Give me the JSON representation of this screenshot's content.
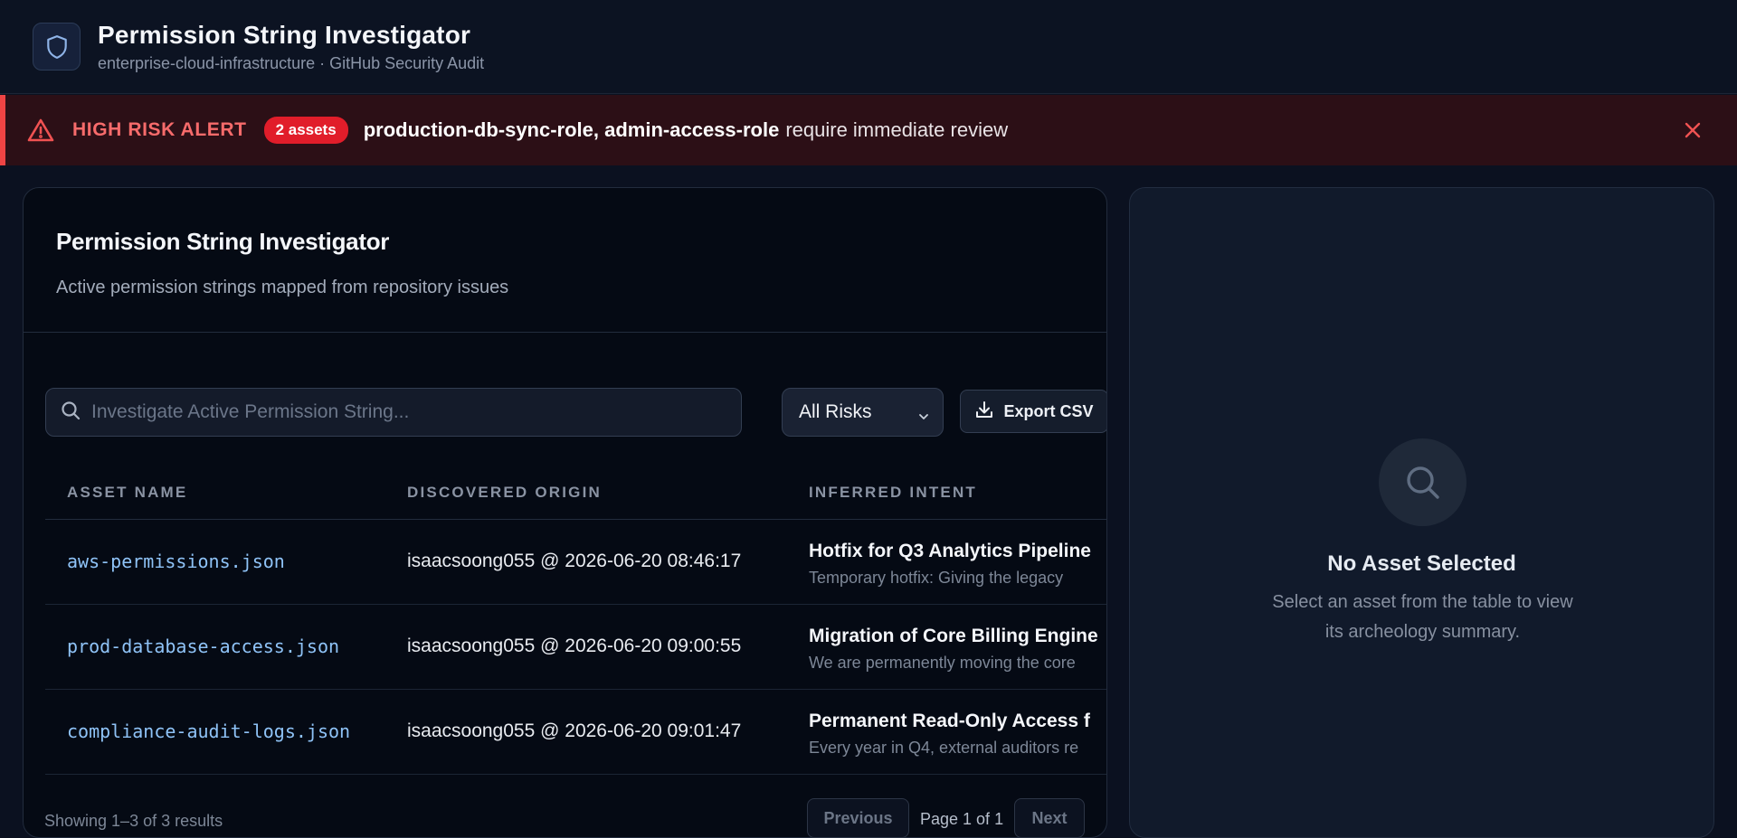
{
  "header": {
    "title": "Permission String Investigator",
    "subtitle": "enterprise-cloud-infrastructure · GitHub Security Audit"
  },
  "alert": {
    "title": "HIGH RISK ALERT",
    "badge": "2 assets",
    "assets": "production-db-sync-role, admin-access-role",
    "message": "require immediate review"
  },
  "panel": {
    "title": "Permission String Investigator",
    "description": "Active permission strings mapped from repository issues"
  },
  "toolbar": {
    "search_placeholder": "Investigate Active Permission String...",
    "risk_filter": "All Risks",
    "export_label": "Export CSV"
  },
  "table": {
    "headers": {
      "asset": "ASSET NAME",
      "origin": "DISCOVERED ORIGIN",
      "intent": "INFERRED INTENT"
    },
    "rows": [
      {
        "asset": "aws-permissions.json",
        "origin": "isaacsoong055 @ 2026-06-20 08:46:17",
        "intent_title": "Hotfix for Q3 Analytics Pipeline",
        "intent_desc": "Temporary hotfix: Giving the legacy"
      },
      {
        "asset": "prod-database-access.json",
        "origin": "isaacsoong055 @ 2026-06-20 09:00:55",
        "intent_title": "Migration of Core Billing Engine",
        "intent_desc": "We are permanently moving the core"
      },
      {
        "asset": "compliance-audit-logs.json",
        "origin": "isaacsoong055 @ 2026-06-20 09:01:47",
        "intent_title": "Permanent Read-Only Access f",
        "intent_desc": "Every year in Q4, external auditors re"
      }
    ]
  },
  "pagination": {
    "results": "Showing 1–3 of 3 results",
    "previous": "Previous",
    "page_info": "Page 1 of 1",
    "next": "Next"
  },
  "side_panel": {
    "empty_title": "No Asset Selected",
    "empty_description": "Select an asset from the table to view its archeology summary."
  },
  "colors": {
    "background": "#0b1120",
    "alert_red": "#ef4444",
    "link_blue": "#8fc3f7"
  },
  "icons": {
    "logo": "shield-icon",
    "alert": "warning-triangle-icon",
    "close": "close-icon",
    "search": "search-icon",
    "dropdown": "chevron-down-icon",
    "export": "download-icon",
    "empty_state": "search-icon"
  }
}
